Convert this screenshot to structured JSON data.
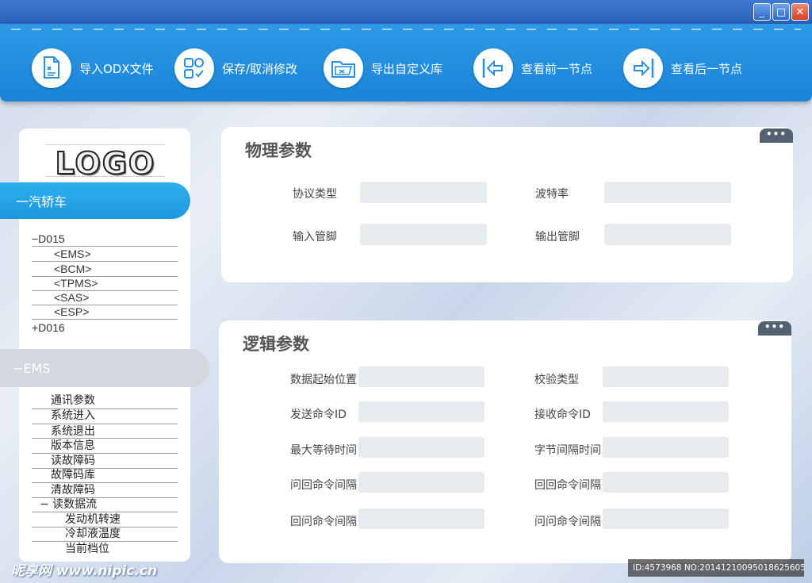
{
  "window": {
    "controls": [
      "_",
      "□",
      "✕"
    ]
  },
  "toolbar": {
    "items": [
      {
        "label": "导入ODX文件",
        "icon": "import-document-icon"
      },
      {
        "label": "保存/取消修改",
        "icon": "save-grid-icon"
      },
      {
        "label": "导出自定义库",
        "icon": "export-folder-icon"
      },
      {
        "label": "查看前一节点",
        "icon": "arrow-left-icon"
      },
      {
        "label": "查看后一节点",
        "icon": "arrow-right-icon"
      }
    ]
  },
  "sidebar": {
    "logo": "LOGO",
    "category": "一汽轿车",
    "tree": {
      "d015": "−D015",
      "children": [
        "<EMS>",
        "<BCM>",
        "<TPMS>",
        "<SAS>",
        "<ESP>"
      ],
      "d016": "+D016"
    },
    "ems_tab": "−EMS",
    "menu": [
      "通讯参数",
      "系统进入",
      "系统退出",
      "版本信息",
      "读故障码",
      "故障码库",
      "清故障码",
      "− 读数据流"
    ],
    "submenu": [
      "发动机转速",
      "冷却液温度",
      "当前档位"
    ]
  },
  "physical": {
    "title": "物理参数",
    "more": "•••",
    "fields": [
      {
        "label": "协议类型",
        "value": ""
      },
      {
        "label": "波特率",
        "value": ""
      },
      {
        "label": "输入管脚",
        "value": ""
      },
      {
        "label": "输出管脚",
        "value": ""
      }
    ]
  },
  "logical": {
    "title": "逻辑参数",
    "more": "•••",
    "fields": [
      {
        "label": "数据起始位置",
        "value": ""
      },
      {
        "label": "校验类型",
        "value": ""
      },
      {
        "label": "发送命令ID",
        "value": ""
      },
      {
        "label": "接收命令ID",
        "value": ""
      },
      {
        "label": "最大等待时间",
        "value": ""
      },
      {
        "label": "字节间隔时间",
        "value": ""
      },
      {
        "label": "问回命令间隔",
        "value": ""
      },
      {
        "label": "回回命令间隔",
        "value": ""
      },
      {
        "label": "回问命令间隔",
        "value": ""
      },
      {
        "label": "问问命令间隔",
        "value": ""
      }
    ]
  },
  "watermark": {
    "left": "昵享网 www.nipic.cn",
    "right": "ID:4573968 NO:20141210095018625605"
  },
  "colors": {
    "toolbar": "#1f8ddc",
    "accent": "#2fb0ee",
    "panel": "#ffffff",
    "input": "#e7ebee"
  }
}
